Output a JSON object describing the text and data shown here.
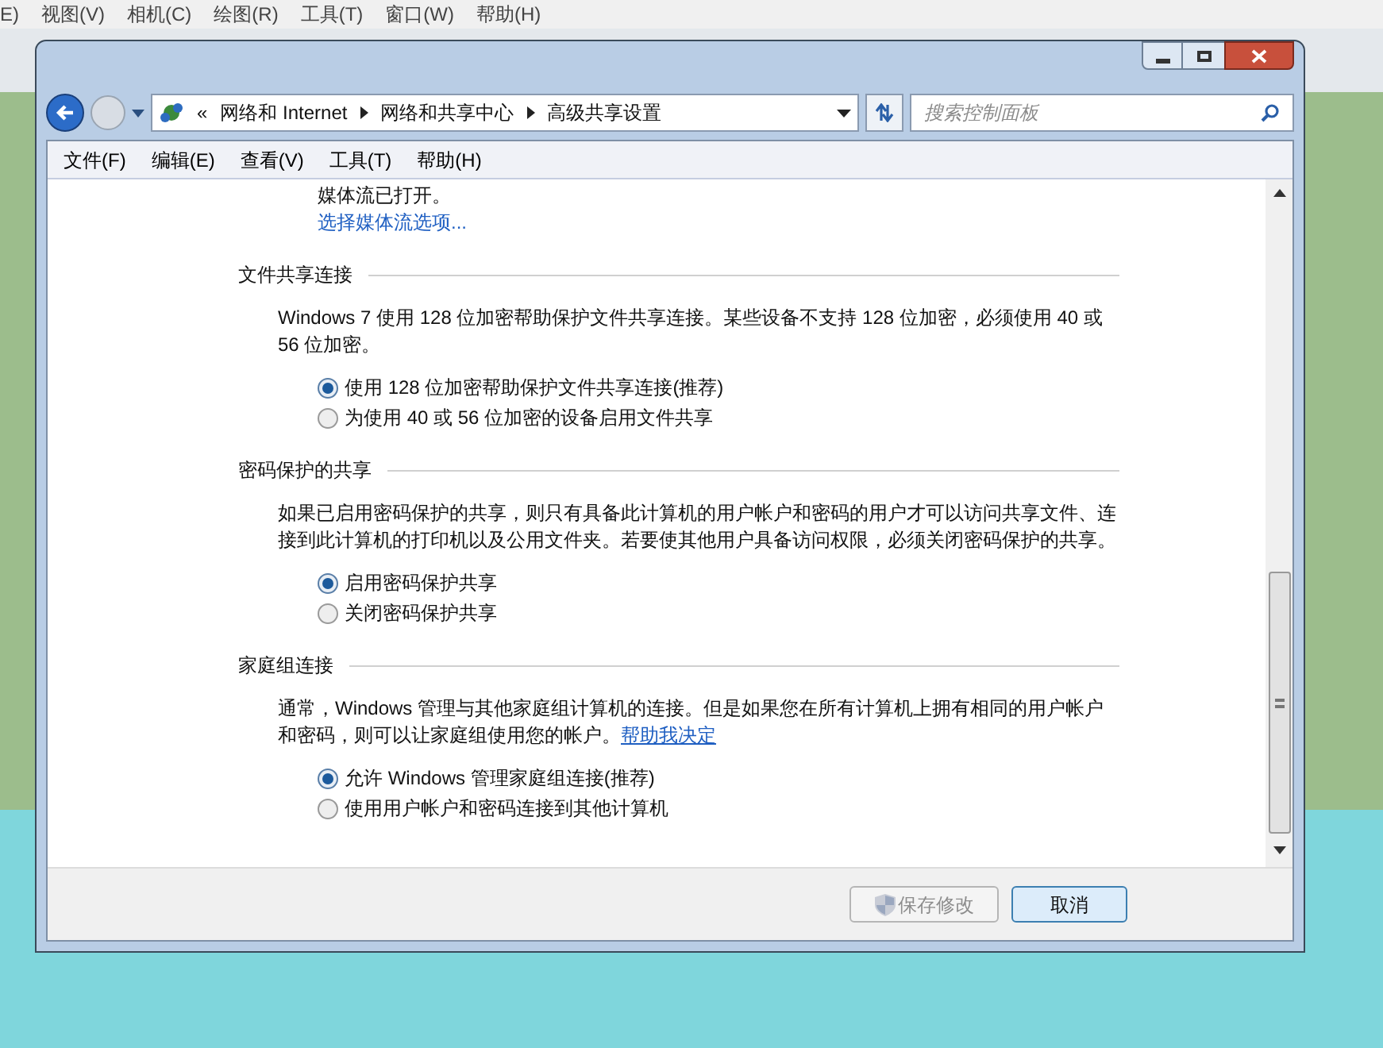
{
  "background_app": {
    "menu": [
      "E)",
      "视图(V)",
      "相机(C)",
      "绘图(R)",
      "工具(T)",
      "窗口(W)",
      "帮助(H)"
    ]
  },
  "address_bar": {
    "prefix": "«",
    "breadcrumb": [
      "网络和 Internet",
      "网络和共享中心",
      "高级共享设置"
    ]
  },
  "search": {
    "placeholder": "搜索控制面板"
  },
  "menu": [
    "文件(F)",
    "编辑(E)",
    "查看(V)",
    "工具(T)",
    "帮助(H)"
  ],
  "content": {
    "intro_text": "媒体流已打开。",
    "intro_link": "选择媒体流选项...",
    "sections": [
      {
        "title": "文件共享连接",
        "description": "Windows 7 使用 128 位加密帮助保护文件共享连接。某些设备不支持 128 位加密，必须使用 40 或 56 位加密。",
        "options": [
          {
            "label": "使用 128 位加密帮助保护文件共享连接(推荐)",
            "selected": true
          },
          {
            "label": "为使用 40 或 56 位加密的设备启用文件共享",
            "selected": false
          }
        ]
      },
      {
        "title": "密码保护的共享",
        "description": "如果已启用密码保护的共享，则只有具备此计算机的用户帐户和密码的用户才可以访问共享文件、连接到此计算机的打印机以及公用文件夹。若要使其他用户具备访问权限，必须关闭密码保护的共享。",
        "options": [
          {
            "label": "启用密码保护共享",
            "selected": true
          },
          {
            "label": "关闭密码保护共享",
            "selected": false
          }
        ]
      },
      {
        "title": "家庭组连接",
        "description": "通常，Windows 管理与其他家庭组计算机的连接。但是如果您在所有计算机上拥有相同的用户帐户和密码，则可以让家庭组使用您的帐户。",
        "link": "帮助我决定",
        "options": [
          {
            "label": "允许 Windows 管理家庭组连接(推荐)",
            "selected": true
          },
          {
            "label": "使用用户帐户和密码连接到其他计算机",
            "selected": false
          }
        ]
      }
    ]
  },
  "buttons": [
    {
      "label": "保存修改",
      "disabled": true,
      "shield": true
    },
    {
      "label": "取消",
      "disabled": false,
      "shield": false
    }
  ]
}
